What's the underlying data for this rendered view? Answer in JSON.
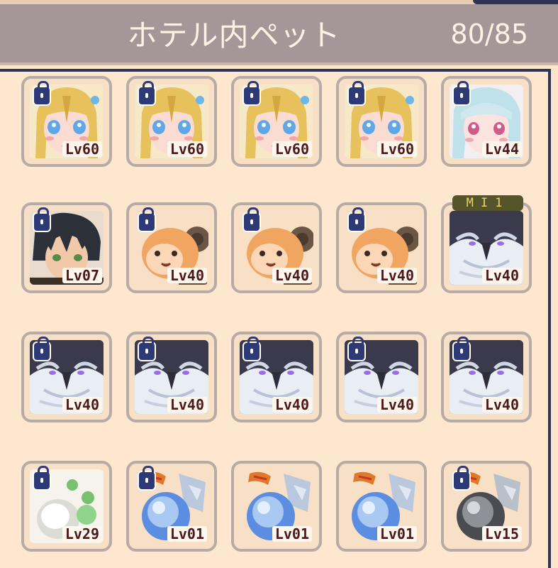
{
  "header": {
    "title": "ホテル内ペット",
    "count": "80/85"
  },
  "grid": [
    {
      "lv": "Lv60",
      "type": "blonde",
      "locked": true
    },
    {
      "lv": "Lv60",
      "type": "blonde",
      "locked": true
    },
    {
      "lv": "Lv60",
      "type": "blonde",
      "locked": true
    },
    {
      "lv": "Lv60",
      "type": "blonde",
      "locked": true
    },
    {
      "lv": "Lv44",
      "type": "silver",
      "locked": true
    },
    {
      "lv": "Lv07",
      "type": "darkhair",
      "locked": true
    },
    {
      "lv": "Lv40",
      "type": "monkey",
      "locked": true
    },
    {
      "lv": "Lv40",
      "type": "monkey",
      "locked": true
    },
    {
      "lv": "Lv40",
      "type": "monkey",
      "locked": true
    },
    {
      "lv": "Lv40",
      "type": "beast",
      "locked": false,
      "badge": "MI1"
    },
    {
      "lv": "Lv40",
      "type": "beast",
      "locked": true
    },
    {
      "lv": "Lv40",
      "type": "beast",
      "locked": true
    },
    {
      "lv": "Lv40",
      "type": "beast",
      "locked": true
    },
    {
      "lv": "Lv40",
      "type": "beast",
      "locked": true
    },
    {
      "lv": "Lv40",
      "type": "beast",
      "locked": true
    },
    {
      "lv": "Lv29",
      "type": "whitebeast",
      "locked": true
    },
    {
      "lv": "Lv01",
      "type": "blueorb",
      "locked": true
    },
    {
      "lv": "Lv01",
      "type": "blueorb",
      "locked": false
    },
    {
      "lv": "Lv01",
      "type": "blueorb",
      "locked": false
    },
    {
      "lv": "Lv15",
      "type": "greyorb",
      "locked": true
    }
  ]
}
